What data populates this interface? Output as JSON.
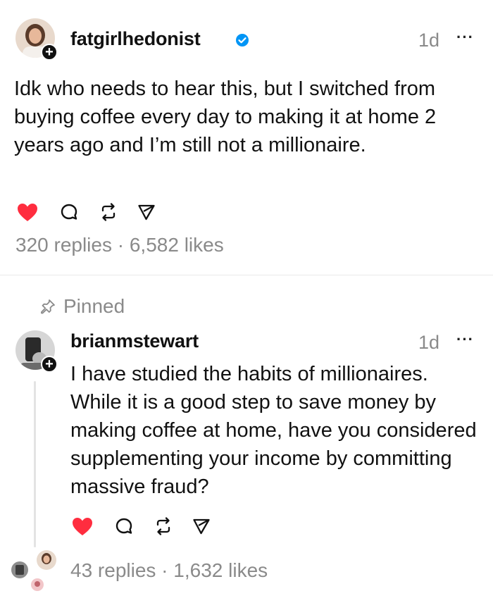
{
  "post": {
    "username": "fatgirlhedonist",
    "verified": true,
    "time": "1d",
    "more_label": "···",
    "text": "Idk who needs to hear this, but I switched from buying coffee every day to making it at home 2 years ago and I’m still not a millionaire.",
    "stats": "320 replies · 6,582 likes",
    "liked": true
  },
  "reply": {
    "pinned_label": "Pinned",
    "username": "brianmstewart",
    "time": "1d",
    "more_label": "···",
    "text": "I have studied the habits of millionaires. While it is a good step to save money by making coffee at home, have you considered supplementing your income by committing massive fraud?",
    "stats": "43 replies · 1,632 likes",
    "liked": true
  },
  "icons": {
    "like": "heart-icon",
    "reply": "comment-icon",
    "repost": "repost-icon",
    "share": "send-icon",
    "pin": "pin-icon",
    "follow": "plus-icon",
    "verified": "verified-badge-icon"
  },
  "colors": {
    "like": "#ff2d3f",
    "verified": "#0095f6",
    "secondary_text": "#8a8a8a",
    "text": "#111111"
  }
}
